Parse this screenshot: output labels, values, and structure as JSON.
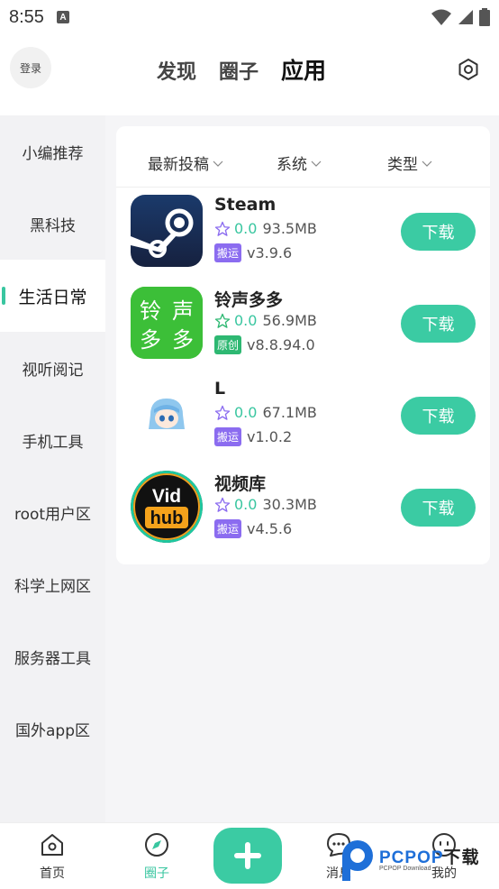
{
  "status_bar": {
    "time": "8:55",
    "notif_icon": "A"
  },
  "header": {
    "login_label": "登录",
    "tabs": [
      {
        "label": "发现",
        "active": false
      },
      {
        "label": "圈子",
        "active": false
      },
      {
        "label": "应用",
        "active": true
      }
    ],
    "settings_icon": "settings-icon"
  },
  "sidebar": {
    "items": [
      {
        "label": "小编推荐",
        "active": false
      },
      {
        "label": "黑科技",
        "active": false
      },
      {
        "label": "生活日常",
        "active": true
      },
      {
        "label": "视听阅记",
        "active": false
      },
      {
        "label": "手机工具",
        "active": false
      },
      {
        "label": "root用户区",
        "active": false
      },
      {
        "label": "科学上网区",
        "active": false
      },
      {
        "label": "服务器工具",
        "active": false
      },
      {
        "label": "国外app区",
        "active": false
      }
    ]
  },
  "filters": [
    "最新投稿",
    "系统",
    "类型"
  ],
  "apps": [
    {
      "name": "Steam",
      "rating": "0.0",
      "size": "93.5MB",
      "badge": "搬运",
      "badge_color": "#8b6cf0",
      "version": "v3.9.6",
      "button": "下载"
    },
    {
      "name": "铃声多多",
      "rating": "0.0",
      "size": "56.9MB",
      "badge": "原创",
      "badge_color": "#2eb872",
      "version": "v8.8.94.0",
      "button": "下载",
      "icon_text": [
        "铃",
        "声",
        "多",
        "多"
      ]
    },
    {
      "name": "L",
      "rating": "0.0",
      "size": "67.1MB",
      "badge": "搬运",
      "badge_color": "#8b6cf0",
      "version": "v1.0.2",
      "button": "下载"
    },
    {
      "name": "视频库",
      "rating": "0.0",
      "size": "30.3MB",
      "badge": "搬运",
      "badge_color": "#8b6cf0",
      "version": "v4.5.6",
      "button": "下载",
      "icon_text": [
        "Vid",
        "hub"
      ]
    }
  ],
  "bottom_nav": [
    {
      "label": "首页",
      "icon": "home-icon",
      "active": false
    },
    {
      "label": "圈子",
      "icon": "compass-icon",
      "active": true
    },
    {
      "label": "消息",
      "icon": "message-icon",
      "active": false
    },
    {
      "label": "我的",
      "icon": "profile-icon",
      "active": false
    }
  ],
  "watermark": {
    "brand": "PCPOP",
    "suffix": "下载",
    "sub": "PCPOP Download"
  },
  "colors": {
    "accent": "#3bcba3",
    "badge_purple": "#8b6cf0",
    "badge_green": "#2eb872"
  }
}
